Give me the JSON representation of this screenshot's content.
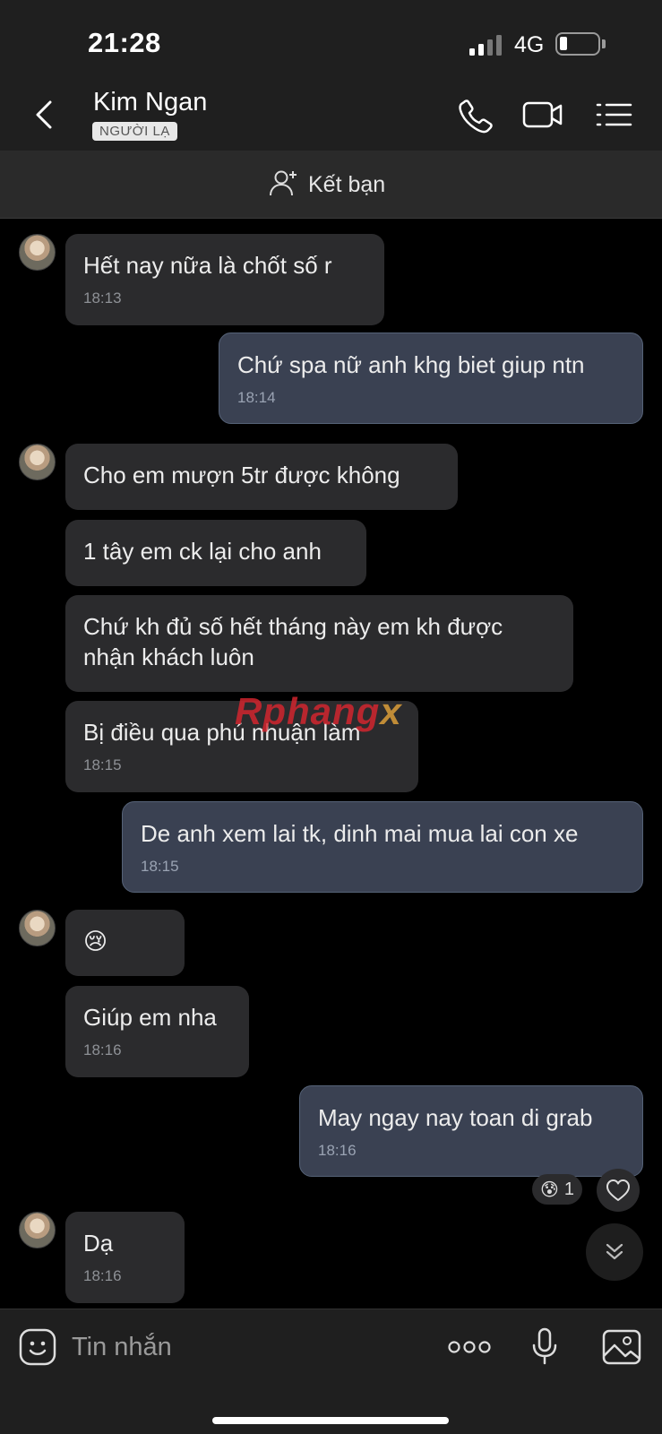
{
  "status_bar": {
    "time": "21:28",
    "network": "4G"
  },
  "header": {
    "contact_name": "Kim Ngan",
    "badge": "NGƯỜI LẠ"
  },
  "friend_bar": {
    "label": "Kết bạn"
  },
  "messages": [
    {
      "dir": "in",
      "text": "Hết nay nữa là chốt số r",
      "time": "18:13"
    },
    {
      "dir": "out",
      "text": "Chứ spa nữ anh khg biet giup ntn",
      "time": "18:14"
    },
    {
      "dir": "in",
      "text": "Cho em mượn 5tr được không"
    },
    {
      "dir": "in",
      "text": "1 tây em ck lại cho anh"
    },
    {
      "dir": "in",
      "text": "Chứ kh đủ số hết tháng này em kh được nhận khách luôn"
    },
    {
      "dir": "in",
      "text": "Bị điều qua phú nhuận làm",
      "time": "18:15"
    },
    {
      "dir": "out",
      "text": "De anh xem lai tk, dinh mai mua lai con xe",
      "time": "18:15"
    },
    {
      "dir": "in",
      "text": "😢"
    },
    {
      "dir": "in",
      "text": "Giúp em nha",
      "time": "18:16"
    },
    {
      "dir": "out",
      "text": "May ngay nay toan di grab",
      "time": "18:16"
    },
    {
      "dir": "in",
      "text": "Dạ",
      "time": "18:16"
    }
  ],
  "reaction": {
    "emoji": "😰",
    "count": "1"
  },
  "watermark": {
    "part1": "Rphang",
    "part2": "x"
  },
  "input": {
    "placeholder": "Tin nhắn"
  },
  "icons": [
    "back-icon",
    "phone-icon",
    "video-icon",
    "menu-icon",
    "add-friend-icon",
    "heart-icon",
    "double-chevron-down-icon",
    "sticker-icon",
    "more-icon",
    "microphone-icon",
    "image-icon"
  ],
  "colors": {
    "incoming_bubble": "#2b2b2d",
    "outgoing_bubble": "#3a4152",
    "background": "#000000",
    "bar": "#1f1f1f"
  }
}
